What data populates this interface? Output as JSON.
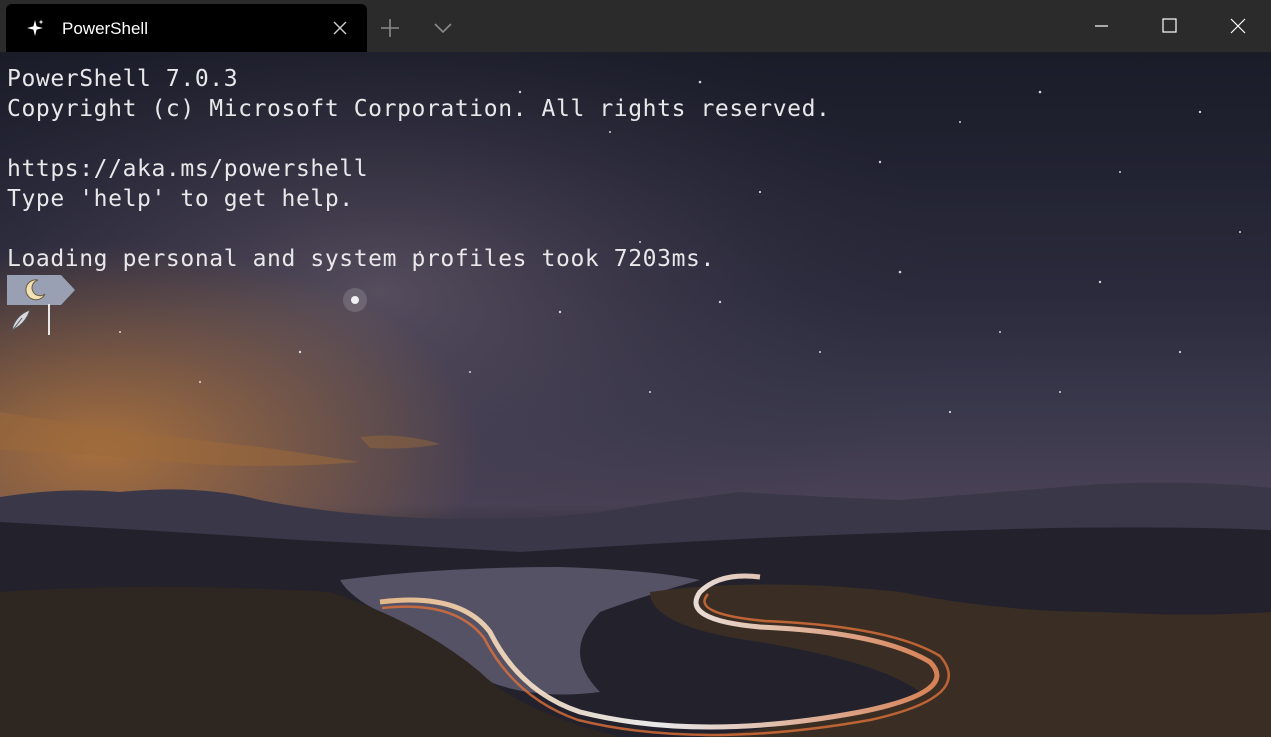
{
  "tab": {
    "title": "PowerShell",
    "icon": "powershell-sparkle-icon"
  },
  "titlebar_controls": {
    "new_tab_icon": "plus-icon",
    "dropdown_icon": "chevron-down-icon",
    "minimize_icon": "minimize-icon",
    "maximize_icon": "maximize-icon",
    "close_icon": "close-icon"
  },
  "terminal": {
    "lines": [
      "PowerShell 7.0.3",
      "Copyright (c) Microsoft Corporation. All rights reserved.",
      "",
      "https://aka.ms/powershell",
      "Type 'help' to get help.",
      "",
      "Loading personal and system profiles took 7203ms."
    ],
    "prompt_segment_icon": "moon-icon",
    "prompt_symbol_icon": "quill-icon",
    "text_color": "#e8e8ea",
    "prompt_segment_color": "#9aa0b4"
  },
  "colors": {
    "titlebar": "#2b2b2b",
    "active_tab": "#000000",
    "sky_top": "#1b1d2a",
    "horizon_glow": "#b9783a"
  }
}
